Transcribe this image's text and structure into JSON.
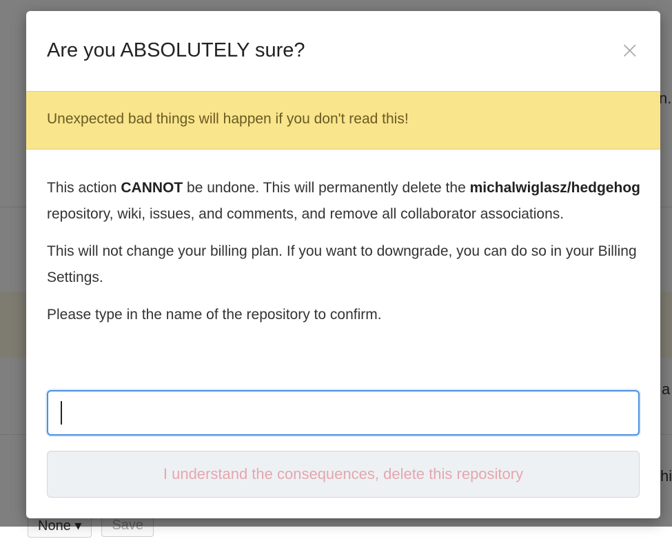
{
  "background": {
    "fragments": [
      "n.",
      "a",
      "hi"
    ],
    "bottom_controls": {
      "dropdown_label": "None ▾",
      "save_label": "Save"
    }
  },
  "modal": {
    "title": "Are you ABSOLUTELY sure?",
    "close_glyph": "×",
    "warning": "Unexpected bad things will happen if you don't read this!",
    "paragraph1": {
      "part1": "This action ",
      "bold1": "CANNOT",
      "part2": " be undone. This will permanently delete the ",
      "bold2": "michalwiglasz/hedgehog",
      "part3": " repository, wiki, issues, and comments, and remove all collaborator associations."
    },
    "paragraph2": "This will not change your billing plan. If you want to downgrade, you can do so in your Billing Settings.",
    "paragraph3": "Please type in the name of the repository to confirm.",
    "input": {
      "value": "",
      "placeholder": ""
    },
    "delete_button_label": "I understand the consequences, delete this repository"
  },
  "colors": {
    "warning_bg": "#f8e58c",
    "danger_text_disabled": "#e4a7ae",
    "focus_border": "#4a90e2"
  }
}
